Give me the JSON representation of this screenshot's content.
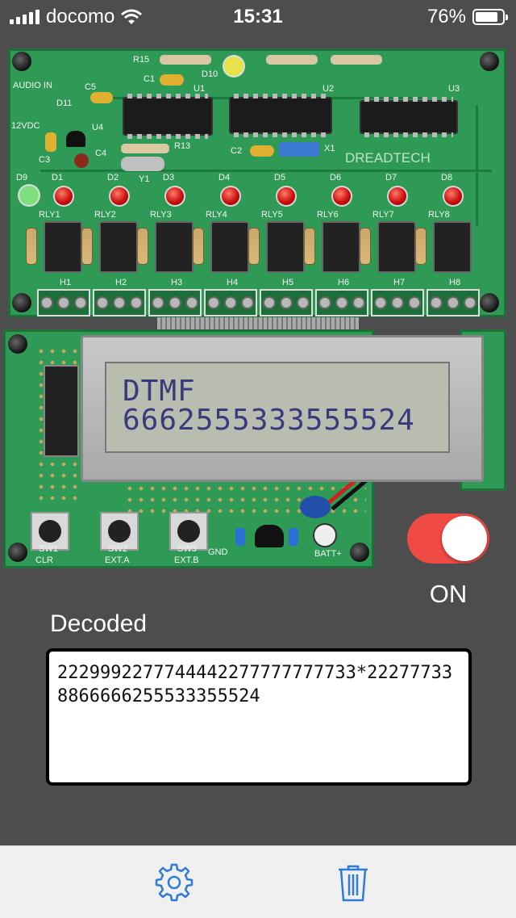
{
  "status_bar": {
    "carrier": "docomo",
    "time": "15:31",
    "battery": "76%"
  },
  "lcd": {
    "line1": "DTMF",
    "line2": "6662555333555524"
  },
  "pcb": {
    "brand": "DREADTECH",
    "labels": {
      "audio_in": "AUDIO IN",
      "vdc": "12VDC",
      "u1": "U1",
      "u2": "U2",
      "u3": "U3",
      "u4": "U4",
      "r15": "R15",
      "r13": "R13",
      "d10": "D10",
      "d11": "D11",
      "c1": "C1",
      "c2": "C2",
      "c3": "C3",
      "c4": "C4",
      "c5": "C5",
      "x1": "X1",
      "y1": "Y1",
      "d9": "D9"
    },
    "leds": [
      "D1",
      "D2",
      "D3",
      "D4",
      "D5",
      "D6",
      "D7",
      "D8"
    ],
    "relays": [
      "RLY1",
      "RLY2",
      "RLY3",
      "RLY4",
      "RLY5",
      "RLY6",
      "RLY7",
      "RLY8"
    ],
    "headers": [
      "H1",
      "H2",
      "H3",
      "H4",
      "H5",
      "H6",
      "H7",
      "H8"
    ]
  },
  "lcd_board": {
    "buttons": [
      {
        "name": "SW1",
        "label": "CLR"
      },
      {
        "name": "SW2",
        "label": "EXT.A"
      },
      {
        "name": "SW3",
        "label": "EXT.B"
      }
    ],
    "gnd": "GND",
    "batt": "BATT+"
  },
  "toggle": {
    "state": "ON",
    "on_color": "#f04a45"
  },
  "decoded": {
    "label": "Decoded",
    "text": "2229992277744442277777777733*222777338866666255533355524"
  },
  "tab_bar": {
    "items": [
      {
        "icon": "gear-icon"
      },
      {
        "icon": "trash-icon"
      }
    ],
    "accent": "#2f7bd8"
  }
}
